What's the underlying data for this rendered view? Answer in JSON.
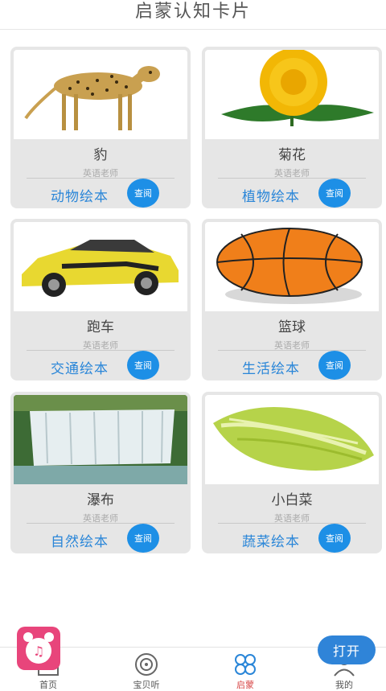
{
  "header": {
    "title": "启蒙认知卡片"
  },
  "cards": [
    {
      "title": "豹",
      "teacher": "英语老师",
      "category": "动物绘本",
      "button": "查阅",
      "image": "cheetah-image"
    },
    {
      "title": "菊花",
      "teacher": "英语老师",
      "category": "植物绘本",
      "button": "查阅",
      "image": "chrysanthemum-image"
    },
    {
      "title": "跑车",
      "teacher": "英语老师",
      "category": "交通绘本",
      "button": "查阅",
      "image": "sports-car-image"
    },
    {
      "title": "篮球",
      "teacher": "英语老师",
      "category": "生活绘本",
      "button": "查阅",
      "image": "basketball-image"
    },
    {
      "title": "瀑布",
      "teacher": "英语老师",
      "category": "自然绘本",
      "button": "查阅",
      "image": "waterfall-image"
    },
    {
      "title": "小白菜",
      "teacher": "英语老师",
      "category": "蔬菜绘本",
      "button": "查阅",
      "image": "cabbage-image"
    }
  ],
  "tabs": [
    {
      "label": "首页",
      "icon": "home-icon"
    },
    {
      "label": "宝贝听",
      "icon": "disc-icon"
    },
    {
      "label": "启蒙",
      "icon": "clover-icon",
      "active": true
    },
    {
      "label": "我的",
      "icon": "user-icon"
    }
  ],
  "floating": {
    "open_label": "打开",
    "app_icon": "alarm-clock-app-icon"
  },
  "colors": {
    "accent": "#2a86d8",
    "button": "#1d8fe6",
    "active_tab": "#d84a4a",
    "card_bg": "#e6e6e6"
  }
}
